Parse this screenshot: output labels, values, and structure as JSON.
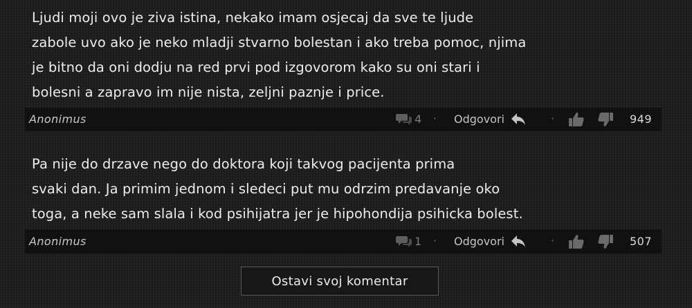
{
  "comments": [
    {
      "lines": [
        "Ljudi moji ovo je ziva istina, nekako imam osjecaj da sve te ljude",
        "zabole uvo ako je neko mladji stvarno bolestan i ako treba pomoc, njima",
        "je bitno da oni dodju na red prvi pod izgovorom kako su oni stari i",
        "bolesni a zapravo im nije nista, zeljni paznje i price."
      ],
      "author": "Anonimus",
      "reply_count": "4",
      "reply_label": "Odgovori",
      "score": "949"
    },
    {
      "lines": [
        "Pa nije do drzave nego do doktora koji takvog pacijenta prima",
        "svaki dan. Ja primim jednom i sledeci put mu odrzim predavanje oko",
        "toga, a neke sam slala i kod psihijatra jer je hipohondija psihicka bolest."
      ],
      "author": "Anonimus",
      "reply_count": "1",
      "reply_label": "Odgovori",
      "score": "507"
    }
  ],
  "cta": {
    "label": "Ostavi svoj komentar"
  },
  "separator": "·",
  "icons": {
    "replies": "speech-bubbles-icon",
    "reply": "reply-arrow-icon",
    "like": "thumbs-up-icon",
    "dislike": "thumbs-down-icon"
  },
  "colors": {
    "background": "#1c1c1c",
    "meta_bar": "#0c0c0c",
    "text": "#ededed",
    "muted": "#6e6e6e"
  }
}
